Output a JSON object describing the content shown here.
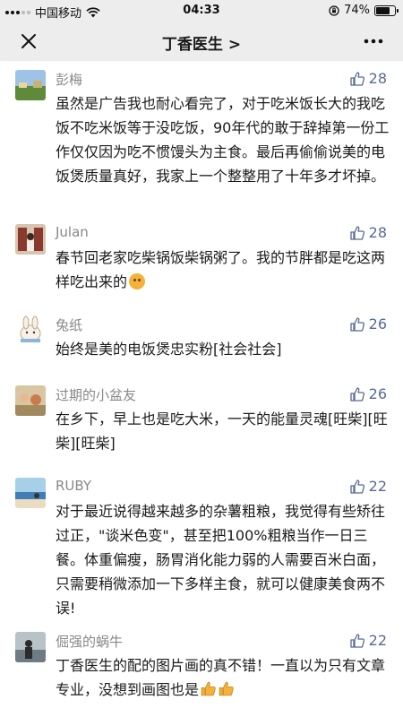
{
  "status_bar": {
    "carrier": "中国移动",
    "time": "04:33",
    "battery": "74%",
    "battery_level": 0.74
  },
  "nav": {
    "title": "丁香医生 >"
  },
  "comments": [
    {
      "author": "彭梅",
      "likes": "28",
      "text": "虽然是广告我也耐心看完了，对于吃米饭长大的我吃饭不吃米饭等于没吃饭，90年代的敢于辞掉第一份工作仅仅因为吃不惯馒头为主食。最后再偷偷说美的电饭煲质量真好，我家上一个整整用了十年多才坏掉。"
    },
    {
      "author": "Julan",
      "likes": "28",
      "text": "春节回老家吃柴锅饭柴锅粥了。我的节胖都是吃这两样吃出来的",
      "emoji": "hugging-face-emoji"
    },
    {
      "author": "兔纸",
      "likes": "26",
      "text": "始终是美的电饭煲忠实粉[社会社会]"
    },
    {
      "author": "过期的小盆友",
      "likes": "26",
      "text": "在乡下，早上也是吃大米，一天的能量灵魂[旺柴][旺柴][旺柴]"
    },
    {
      "author": "RUBY",
      "likes": "22",
      "text": "对于最近说得越来越多的杂薯粗粮，我觉得有些矫往过正，\"谈米色变\"，甚至把100%粗粮当作一日三餐。体重偏瘦，肠胃消化能力弱的人需要百米白面，只需要稍微添加一下多样主食，就可以健康美食两不误!"
    },
    {
      "author": "倔强的蜗牛",
      "likes": "22",
      "text": "丁香医生的配的图片画的真不错！一直以为只有文章专业，没想到画图也是",
      "emoji": "thumbs-up-emoji"
    }
  ],
  "colors": {
    "bar_bg": "#ededed",
    "author": "#888888",
    "like_blue": "#576b95",
    "text": "#1a1a1a"
  }
}
